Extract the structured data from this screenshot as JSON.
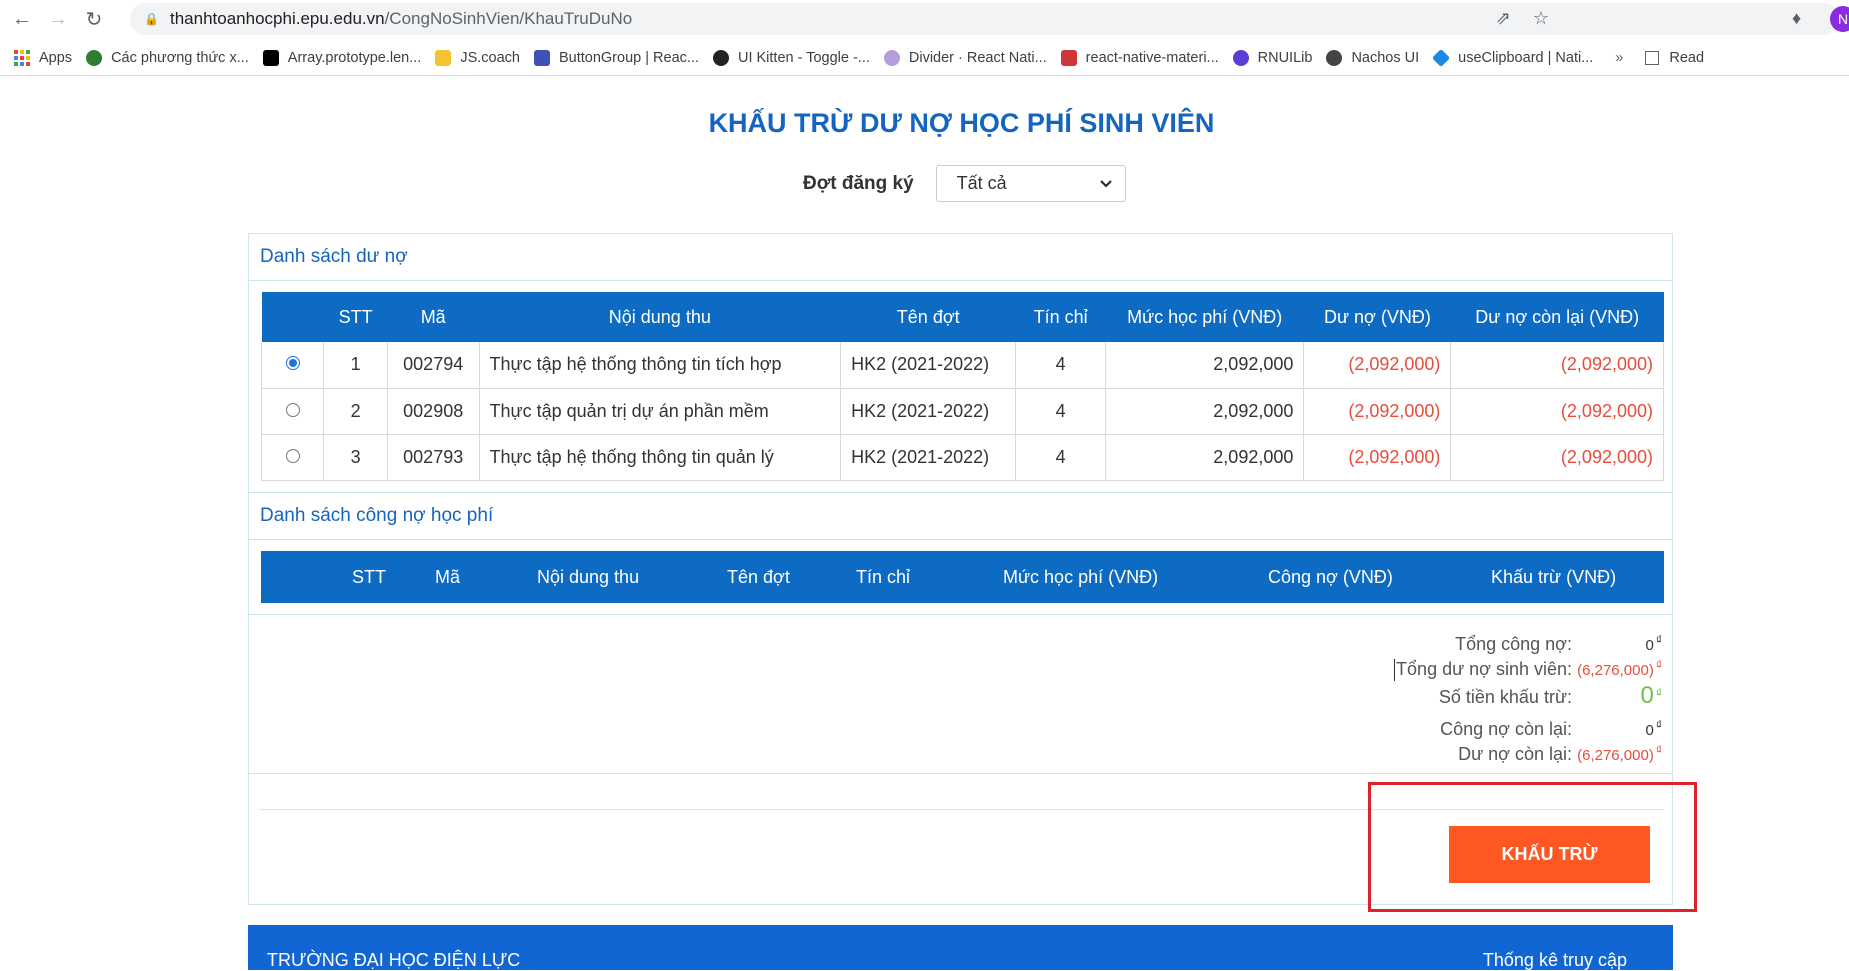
{
  "browser": {
    "url_host": "thanhtoanhocphi.epu.edu.vn",
    "url_path": "/CongNoSinhVien/KhauTruDuNo",
    "avatar_letter": "N",
    "bookmarks": [
      {
        "label": "Apps",
        "icon": "apps-grid-icon"
      },
      {
        "label": "Các phương thức x...",
        "icon": "globe-green-icon"
      },
      {
        "label": "Array.prototype.len...",
        "icon": "mdn-icon"
      },
      {
        "label": "JS.coach",
        "icon": "jscoach-icon"
      },
      {
        "label": "ButtonGroup | Reac...",
        "icon": "nativebase-icon"
      },
      {
        "label": "UI Kitten - Toggle -...",
        "icon": "kitten-icon"
      },
      {
        "label": "Divider · React Nati...",
        "icon": "feather-icon"
      },
      {
        "label": "react-native-materi...",
        "icon": "npm-icon"
      },
      {
        "label": "RNUILib",
        "icon": "rnuilib-icon"
      },
      {
        "label": "Nachos UI",
        "icon": "nachos-icon"
      },
      {
        "label": "useClipboard | Nati...",
        "icon": "nativebase-diamond-icon"
      }
    ],
    "more": "»",
    "reading_list": "Read"
  },
  "page": {
    "title": "KHẤU TRỪ DƯ NỢ HỌC PHÍ SINH VIÊN",
    "filter_label": "Đợt đăng ký",
    "filter_value": "Tất cả"
  },
  "debt_section": {
    "title": "Danh sách dư nợ",
    "headers": [
      "",
      "STT",
      "Mã",
      "Nội dung thu",
      "Tên đợt",
      "Tín chỉ",
      "Mức học phí (VNĐ)",
      "Dư nợ (VNĐ)",
      "Dư nợ còn lại (VNĐ)"
    ],
    "rows": [
      {
        "selected": true,
        "stt": "1",
        "ma": "002794",
        "noi_dung": "Thực tập hệ thống thông tin tích hợp",
        "ten_dot": "HK2 (2021-2022)",
        "tin_chi": "4",
        "muc_hoc_phi": "2,092,000",
        "du_no": "(2,092,000)",
        "du_no_con_lai": "(2,092,000)"
      },
      {
        "selected": false,
        "stt": "2",
        "ma": "002908",
        "noi_dung": "Thực tập quản trị dự án phần mềm",
        "ten_dot": "HK2 (2021-2022)",
        "tin_chi": "4",
        "muc_hoc_phi": "2,092,000",
        "du_no": "(2,092,000)",
        "du_no_con_lai": "(2,092,000)"
      },
      {
        "selected": false,
        "stt": "3",
        "ma": "002793",
        "noi_dung": "Thực tập hệ thống thông tin quản lý",
        "ten_dot": "HK2 (2021-2022)",
        "tin_chi": "4",
        "muc_hoc_phi": "2,092,000",
        "du_no": "(2,092,000)",
        "du_no_con_lai": "(2,092,000)"
      }
    ]
  },
  "fee_section": {
    "title": "Danh sách công nợ học phí",
    "headers": [
      "STT",
      "Mã",
      "Nội dung thu",
      "Tên đợt",
      "Tín chỉ",
      "Mức học phí (VNĐ)",
      "Công nợ (VNĐ)",
      "Khấu trừ (VNĐ)"
    ]
  },
  "summary": {
    "unit": "₫",
    "tong_cong_no_label": "Tổng công nợ:",
    "tong_cong_no": "0",
    "tong_du_no_label": "Tổng dư nợ sinh viên:",
    "tong_du_no": "(6,276,000)",
    "so_tien_khau_tru_label": "Số tiền khấu trừ:",
    "so_tien_khau_tru": "0",
    "cong_no_con_lai_label": "Công nợ còn lại:",
    "cong_no_con_lai": "0",
    "du_no_con_lai_label": "Dư nợ còn lại:",
    "du_no_con_lai": "(6,276,000)"
  },
  "actions": {
    "khau_tru_label": "KHẤU TRỪ"
  },
  "footer": {
    "left": "TRƯỜNG ĐẠI HỌC ĐIỆN LỰC",
    "right": "Thống kê truy cập"
  },
  "colors": {
    "brand_blue": "#0d6bc4",
    "title_blue": "#1565c0",
    "debt_red": "#e74c3c",
    "action_orange": "#ff5722",
    "highlight_red": "#e0202b",
    "success_green": "#6cc24a"
  }
}
